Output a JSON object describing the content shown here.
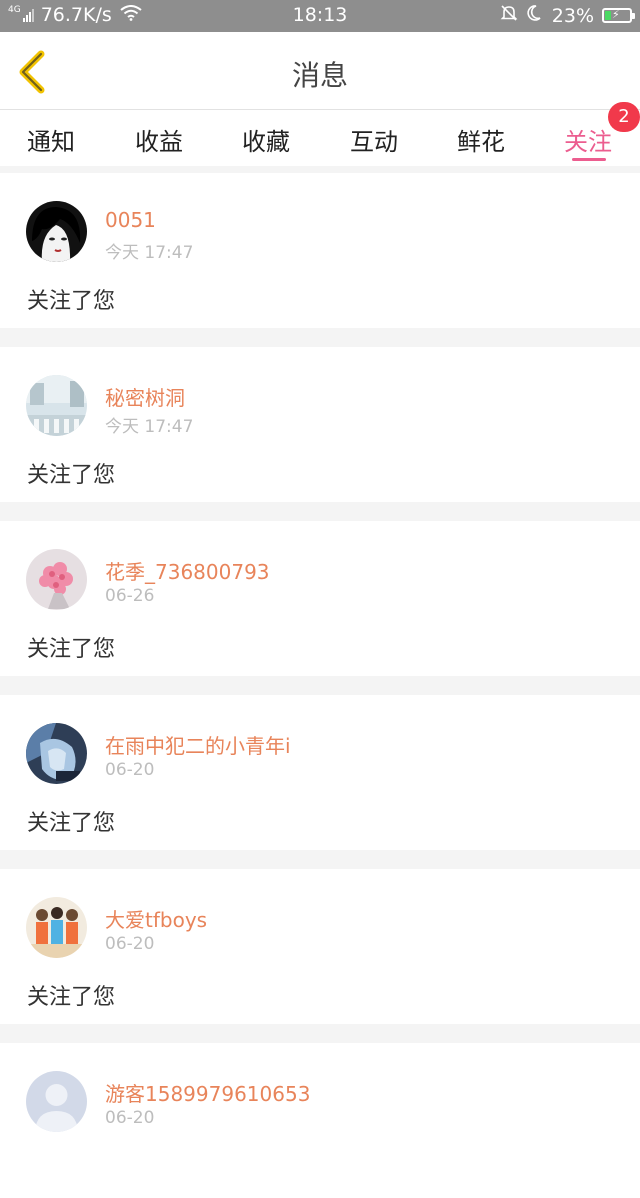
{
  "status_bar": {
    "network_type": "4G",
    "speed": "76.7K/s",
    "time": "18:13",
    "battery": "23%",
    "battery_level": 0.23,
    "icons": [
      "signal-icon",
      "wifi-icon",
      "mute-bell-icon",
      "moon-icon",
      "battery-charging-icon"
    ]
  },
  "header": {
    "title": "消息",
    "back_icon": "chevron-left-icon",
    "accent": "#f2c300"
  },
  "tabs": {
    "items": [
      "通知",
      "收益",
      "收藏",
      "互动",
      "鲜花",
      "关注"
    ],
    "active_index": 5,
    "active_color": "#ec5d8f",
    "badge": "2"
  },
  "notifications": [
    {
      "name": "0051",
      "time": "今天 17:47",
      "message": "关注了您"
    },
    {
      "name": "秘密树洞",
      "time": "今天 17:47",
      "message": "关注了您"
    },
    {
      "name": "花季_736800793",
      "time": "06-26",
      "message": "关注了您"
    },
    {
      "name": "在雨中犯二的小青年i",
      "time": "06-20",
      "message": "关注了您"
    },
    {
      "name": "大爱tfboys",
      "time": "06-20",
      "message": "关注了您"
    },
    {
      "name": "游客1589979610653",
      "time": "06-20",
      "message": ""
    }
  ],
  "colors": {
    "name": "#e8845a",
    "time": "#bdbdbd",
    "badge": "#f1394b"
  }
}
